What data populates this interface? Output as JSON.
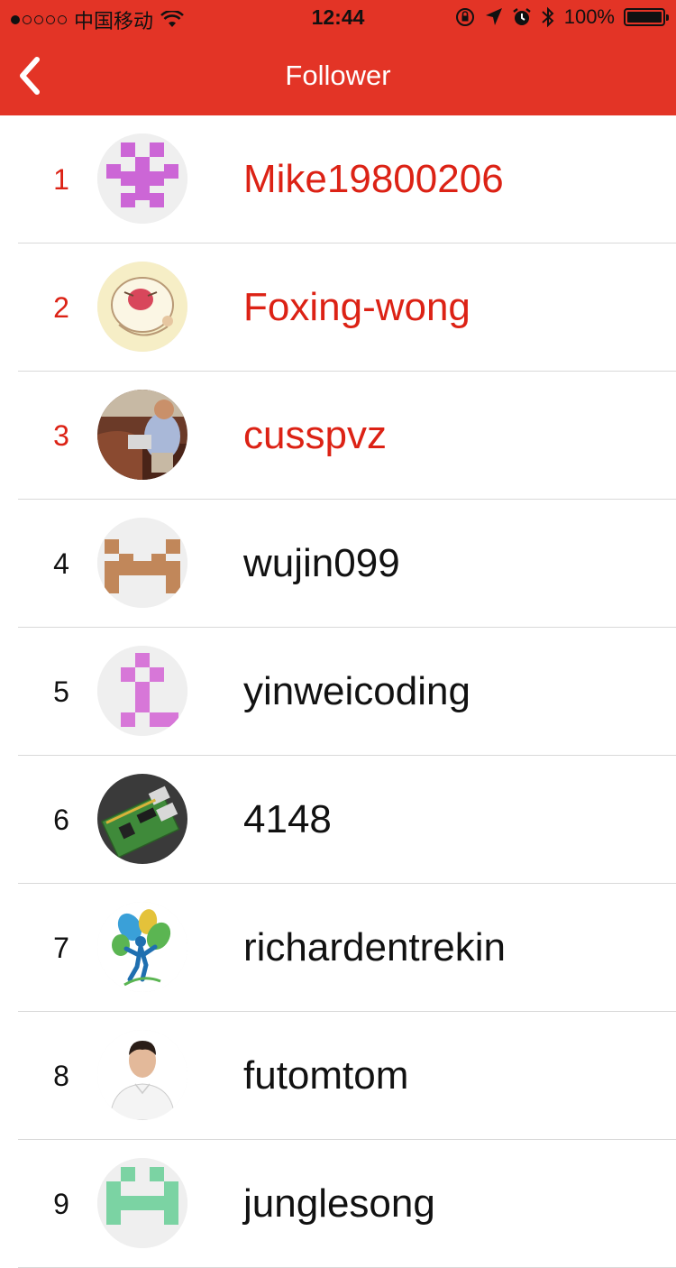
{
  "status_bar": {
    "carrier": "中国移动",
    "time": "12:44",
    "battery": "100%",
    "signal_filled": 1,
    "signal_total": 5
  },
  "nav": {
    "title": "Follower",
    "back_icon": "chevron-left-icon"
  },
  "colors": {
    "header": "#e33426",
    "highlight_text": "#dc2215",
    "separator": "#d9d9d9"
  },
  "followers": [
    {
      "rank": "1",
      "username": "Mike19800206",
      "highlight": true,
      "avatar": "identicon-purple"
    },
    {
      "rank": "2",
      "username": "Foxing-wong",
      "highlight": true,
      "avatar": "cartoon-face"
    },
    {
      "rank": "3",
      "username": "cusspvz",
      "highlight": true,
      "avatar": "photo-person-laptop"
    },
    {
      "rank": "4",
      "username": "wujin099",
      "highlight": false,
      "avatar": "identicon-brown"
    },
    {
      "rank": "5",
      "username": "yinweicoding",
      "highlight": false,
      "avatar": "identicon-pink"
    },
    {
      "rank": "6",
      "username": "4148",
      "highlight": false,
      "avatar": "photo-circuit-board"
    },
    {
      "rank": "7",
      "username": "richardentrekin",
      "highlight": false,
      "avatar": "tree-logo"
    },
    {
      "rank": "8",
      "username": "futomtom",
      "highlight": false,
      "avatar": "photo-portrait"
    },
    {
      "rank": "9",
      "username": "junglesong",
      "highlight": false,
      "avatar": "identicon-green"
    }
  ]
}
